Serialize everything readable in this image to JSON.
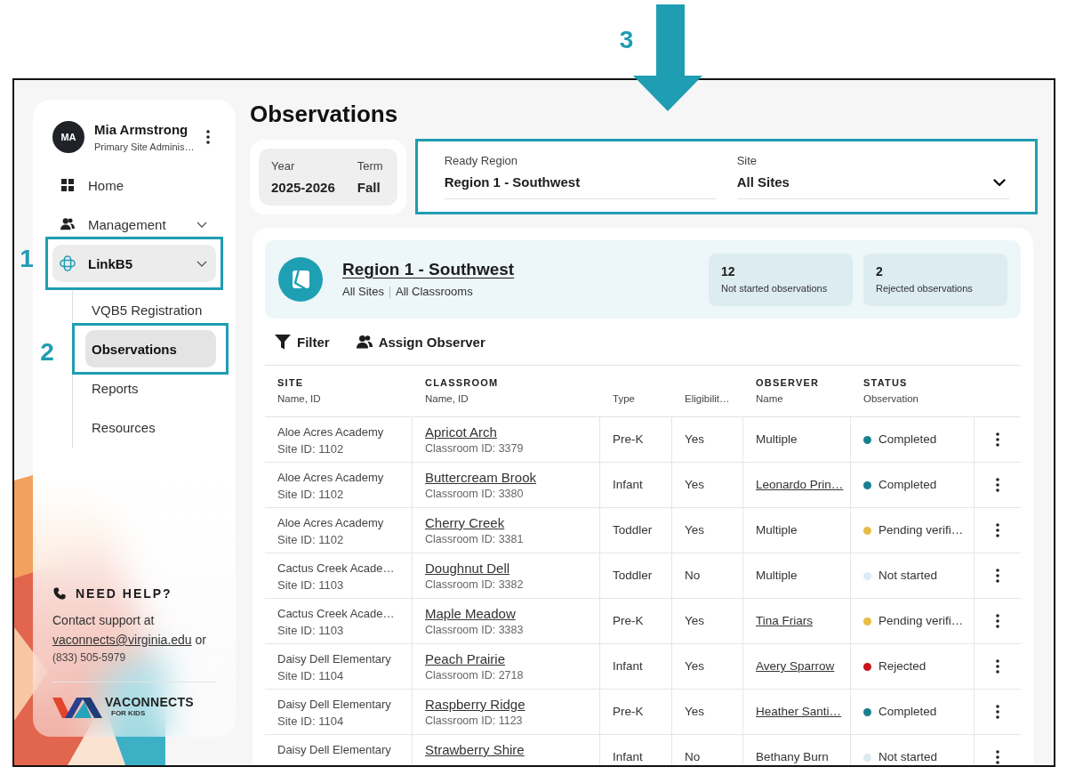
{
  "sidebar": {
    "user": {
      "initials": "MA",
      "name": "Mia Armstrong",
      "role": "Primary Site Adminis…"
    },
    "nav": [
      {
        "label": "Home",
        "kind": "link",
        "selected": false
      },
      {
        "label": "Management",
        "kind": "group",
        "selected": false
      },
      {
        "label": "LinkB5",
        "kind": "group",
        "selected": true,
        "expanded": true,
        "callout": "1",
        "children": [
          {
            "label": "VQB5 Registration",
            "selected": false
          },
          {
            "label": "Observations",
            "selected": true,
            "callout": "2"
          },
          {
            "label": "Reports",
            "selected": false
          },
          {
            "label": "Resources",
            "selected": false
          }
        ]
      }
    ],
    "help": {
      "title": "NEED HELP?",
      "text": "Contact support at",
      "email": "vaconnects@virginia.edu",
      "text_after": "or",
      "phone": "(833) 505-5979"
    },
    "brand": {
      "name": "VACONNECTS",
      "tagline": "FOR KIDS"
    }
  },
  "page": {
    "title": "Observations"
  },
  "period": [
    {
      "label": "Year",
      "value": "2025-2026"
    },
    {
      "label": "Term",
      "value": "Fall"
    }
  ],
  "filters": {
    "callout": "3",
    "fields": [
      {
        "kind": "text",
        "label": "Ready Region",
        "value": "Region 1 - Southwest"
      },
      {
        "kind": "select",
        "label": "Site",
        "value": "All Sites"
      }
    ]
  },
  "summary": {
    "title": "Region 1 - Southwest",
    "scope": [
      "All Sites",
      "All Classrooms"
    ],
    "stats": [
      {
        "value": "12",
        "label": "Not started observations"
      },
      {
        "value": "2",
        "label": "Rejected observations"
      }
    ]
  },
  "toolbar": [
    {
      "label": "Filter"
    },
    {
      "label": "Assign Observer"
    }
  ],
  "table": {
    "columns": [
      {
        "title": "SITE",
        "subtitle": "Name, ID"
      },
      {
        "title": "CLASSROOM",
        "subtitle": "Name, ID"
      },
      {
        "subtitle": "Type"
      },
      {
        "subtitle": "Eligibilit…"
      },
      {
        "title": "OBSERVER",
        "subtitle": "Name"
      },
      {
        "title": "STATUS",
        "subtitle": "Observation"
      }
    ],
    "rows": [
      {
        "site": "Aloe Acres Academy",
        "site_id": "Site ID: 1102",
        "classroom": "Apricot Arch",
        "classroom_id": "Classroom ID: 3379",
        "type": "Pre-K",
        "eligibility": "Yes",
        "observer": {
          "name": "Multiple",
          "link": false
        },
        "status": {
          "label": "Completed",
          "color": "#17808f"
        }
      },
      {
        "site": "Aloe Acres Academy",
        "site_id": "Site ID: 1102",
        "classroom": "Buttercream Brook",
        "classroom_id": "Classroom ID: 3380",
        "type": "Infant",
        "eligibility": "Yes",
        "observer": {
          "name": "Leonardo Prin…",
          "link": true
        },
        "status": {
          "label": "Completed",
          "color": "#17808f"
        }
      },
      {
        "site": "Aloe Acres Academy",
        "site_id": "Site ID: 1102",
        "classroom": "Cherry Creek",
        "classroom_id": "Classroom ID: 3381",
        "type": "Toddler",
        "eligibility": "Yes",
        "observer": {
          "name": "Multiple",
          "link": false
        },
        "status": {
          "label": "Pending verifi…",
          "color": "#e6bd45"
        }
      },
      {
        "site": "Cactus Creek Acade…",
        "site_id": "Site ID: 1103",
        "classroom": "Doughnut Dell",
        "classroom_id": "Classroom ID: 3382",
        "type": "Toddler",
        "eligibility": "No",
        "observer": {
          "name": "Multiple",
          "link": false
        },
        "status": {
          "label": "Not started",
          "color": "#dcebf1"
        }
      },
      {
        "site": "Cactus Creek Acade…",
        "site_id": "Site ID: 1103",
        "classroom": "Maple Meadow",
        "classroom_id": "Classroom ID: 3383",
        "type": "Pre-K",
        "eligibility": "Yes",
        "observer": {
          "name": "Tina Friars",
          "link": true
        },
        "status": {
          "label": "Pending verifi…",
          "color": "#e6bd45"
        }
      },
      {
        "site": "Daisy Dell Elementary",
        "site_id": "Site ID: 1104",
        "classroom": "Peach Prairie",
        "classroom_id": "Classroom ID: 2718",
        "type": "Infant",
        "eligibility": "Yes",
        "observer": {
          "name": "Avery Sparrow",
          "link": true
        },
        "status": {
          "label": "Rejected",
          "color": "#c8151b"
        }
      },
      {
        "site": "Daisy Dell Elementary",
        "site_id": "Site ID: 1104",
        "classroom": "Raspberry Ridge",
        "classroom_id": "Classroom ID: 1123",
        "type": "Pre-K",
        "eligibility": "Yes",
        "observer": {
          "name": "Heather Santi…",
          "link": true
        },
        "status": {
          "label": "Completed",
          "color": "#17808f"
        }
      },
      {
        "site": "Daisy Dell Elementary",
        "classroom": "Strawberry Shire",
        "type": "Infant",
        "eligibility": "No",
        "observer": {
          "name": "Bethany Burn",
          "link": false
        },
        "status": {
          "label": "Not started",
          "color": "#dcebf1"
        }
      }
    ]
  }
}
